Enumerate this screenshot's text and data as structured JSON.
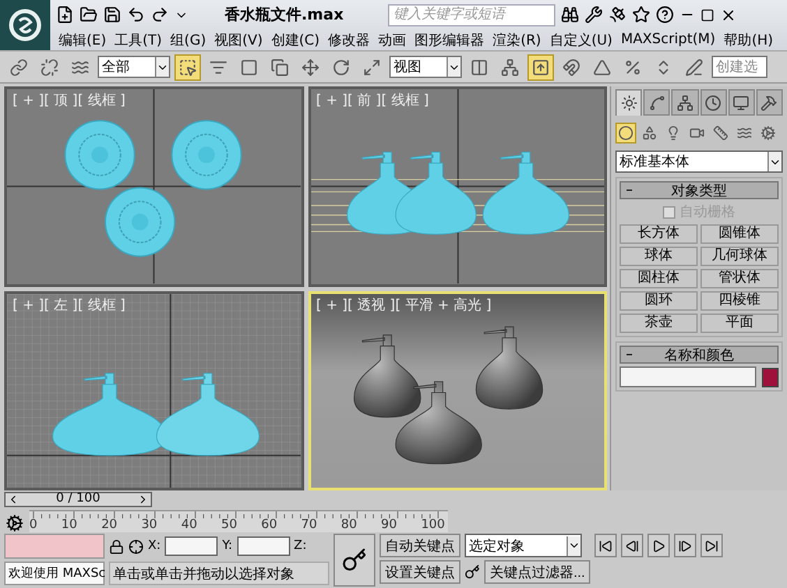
{
  "title_bar": {
    "title": "香水瓶文件.max",
    "search": {
      "placeholder": "键入关键字或短语"
    }
  },
  "menu": [
    "编辑(E)",
    "工具(T)",
    "组(G)",
    "视图(V)",
    "创建(C)",
    "修改器",
    "动画",
    "图形编辑器",
    "渲染(R)",
    "自定义(U)",
    "MAXScript(M)",
    "帮助(H)"
  ],
  "toolbar": {
    "tools": [
      {
        "kind": "icon",
        "selected": false
      },
      {
        "kind": "icon",
        "selected": false
      },
      {
        "kind": "icon",
        "selected": false
      },
      {
        "kind": "dropdown",
        "value": "全部"
      },
      {
        "kind": "icon",
        "selected": true
      },
      {
        "kind": "icon",
        "selected": false
      },
      {
        "kind": "icon",
        "selected": false
      },
      {
        "kind": "icon",
        "selected": false
      },
      {
        "kind": "icon",
        "selected": false
      },
      {
        "kind": "icon",
        "selected": false
      },
      {
        "kind": "icon",
        "selected": false
      },
      {
        "kind": "dropdown",
        "value": "视图"
      },
      {
        "kind": "icon",
        "selected": false
      },
      {
        "kind": "icon",
        "selected": false
      },
      {
        "kind": "icon",
        "selected": true
      },
      {
        "kind": "icon",
        "selected": false
      },
      {
        "kind": "icon",
        "selected": false
      },
      {
        "kind": "icon",
        "selected": false
      },
      {
        "kind": "icon",
        "selected": false
      },
      {
        "kind": "icon",
        "selected": false
      },
      {
        "kind": "field",
        "placeholder": "创建选"
      }
    ]
  },
  "viewports": [
    {
      "label": "[ + ][ 顶 ][ 线框 ]",
      "kind": "top",
      "active": false
    },
    {
      "label": "[ + ][ 前 ][ 线框 ]",
      "kind": "front",
      "active": false
    },
    {
      "label": "[ + ][ 左 ][ 线框 ]",
      "kind": "left",
      "active": false
    },
    {
      "label": "[ + ][ 透视 ][ 平滑 + 高光 ]",
      "kind": "perspective",
      "active": true
    }
  ],
  "command_panel": {
    "tabs": [
      {
        "selected": true
      },
      {
        "selected": false
      },
      {
        "selected": false
      },
      {
        "selected": false
      },
      {
        "selected": false
      },
      {
        "selected": false
      }
    ],
    "categories": [
      {
        "selected": true
      },
      {
        "selected": false
      },
      {
        "selected": false
      },
      {
        "selected": false
      },
      {
        "selected": false
      },
      {
        "selected": false
      },
      {
        "selected": false
      }
    ],
    "type_dropdown": "标准基本体",
    "object_type": {
      "title": "对象类型",
      "expanded": true,
      "autogrid": {
        "label": "自动栅格",
        "checked": false,
        "disabled": true
      },
      "buttons": [
        "长方体",
        "圆锥体",
        "球体",
        "几何球体",
        "圆柱体",
        "管状体",
        "圆环",
        "四棱锥",
        "茶壶",
        "平面"
      ]
    },
    "name_color": {
      "title": "名称和颜色",
      "expanded": true,
      "color": "#a0103c"
    }
  },
  "time_slider": {
    "label": "0 / 100"
  },
  "track_bar": {
    "ticks": [
      "0",
      "10",
      "20",
      "30",
      "40",
      "50",
      "60",
      "70",
      "80",
      "90",
      "100"
    ]
  },
  "status": {
    "welcome": "欢迎使用 MAXSc",
    "prompt": "单击或单击并拖动以选择对象",
    "coords": [
      "X:",
      "Y:",
      "Z:"
    ],
    "auto_key": "自动关键点",
    "set_key": "设置关键点",
    "selection": "选定对象",
    "key_filters": "关键点过滤器..."
  }
}
